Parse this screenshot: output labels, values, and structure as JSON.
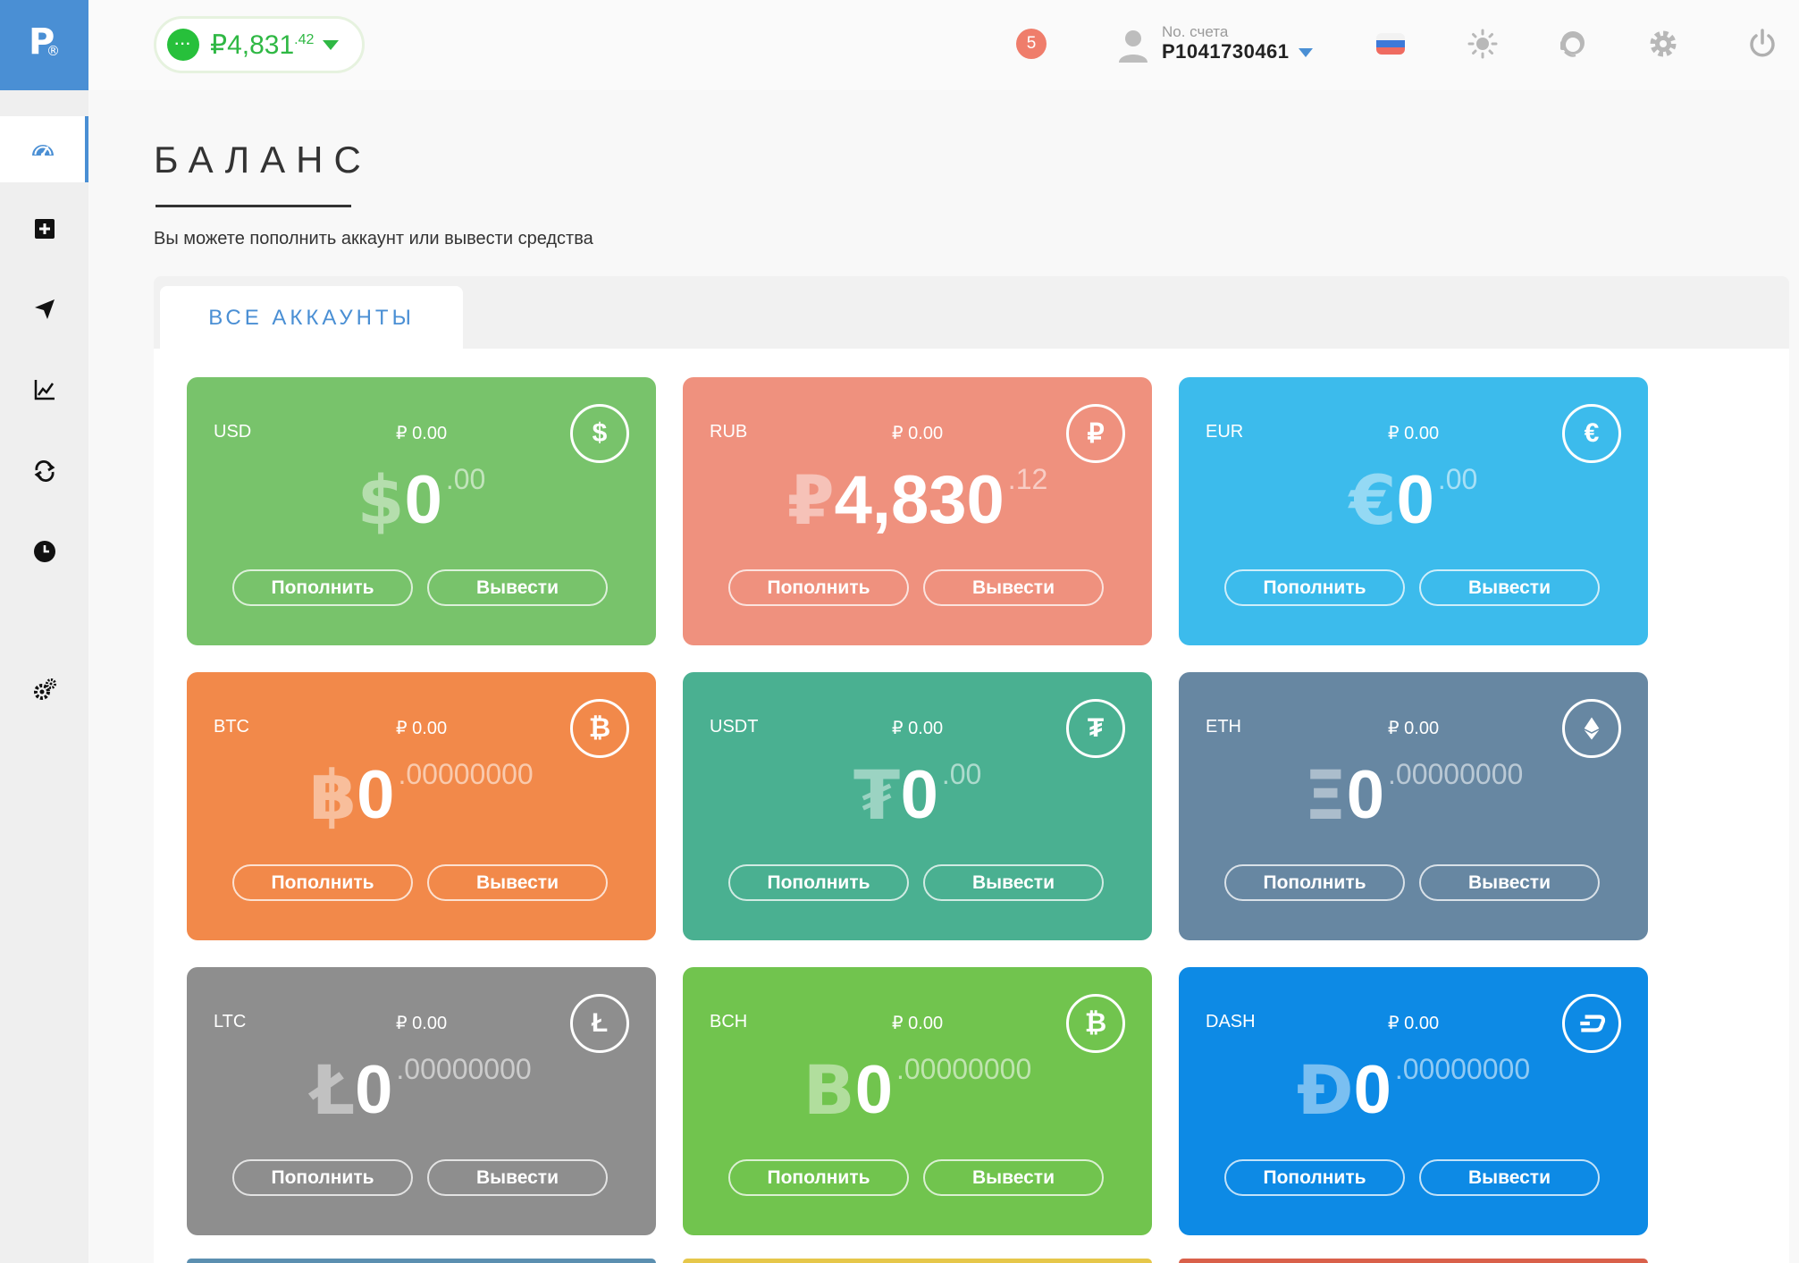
{
  "logo": {
    "letter": "P",
    "mark": "®"
  },
  "header": {
    "balance_main": "₽4,831",
    "balance_cents": ".42",
    "balance_dot": "···",
    "notifications": "5",
    "account_label": "No. счета",
    "account_number": "P1041730461"
  },
  "sidebar": {
    "items": [
      {
        "icon": "dashboard-gauge-icon"
      },
      {
        "icon": "add-square-icon"
      },
      {
        "icon": "send-paper-plane-icon"
      },
      {
        "icon": "chart-line-icon"
      },
      {
        "icon": "exchange-arrows-icon"
      },
      {
        "icon": "history-clock-icon"
      },
      {
        "icon": "settings-gears-icon"
      }
    ]
  },
  "page": {
    "title": "БАЛАНС",
    "subtitle": "Вы можете пополнить аккаунт или вывести средства",
    "tab": "ВСЕ АККАУНТЫ"
  },
  "labels": {
    "deposit": "Пополнить",
    "withdraw": "Вывести"
  },
  "cards": [
    {
      "code": "USD",
      "rub": "₽ 0.00",
      "icon": "$",
      "sym": "$",
      "int": "0",
      "frac": ".00",
      "color": "#78c36b"
    },
    {
      "code": "RUB",
      "rub": "₽ 0.00",
      "icon": "₽",
      "sym": "₽",
      "int": "4,830",
      "frac": ".12",
      "color": "#ef917e"
    },
    {
      "code": "EUR",
      "rub": "₽ 0.00",
      "icon": "€",
      "sym": "€",
      "int": "0",
      "frac": ".00",
      "color": "#3cbbec"
    },
    {
      "code": "BTC",
      "rub": "₽ 0.00",
      "icon": "₿",
      "sym": "฿",
      "int": "0",
      "frac": ".00000000",
      "color": "#f2894a"
    },
    {
      "code": "USDT",
      "rub": "₽ 0.00",
      "icon": "₮",
      "sym": "₮",
      "int": "0",
      "frac": ".00",
      "color": "#4ab091"
    },
    {
      "code": "ETH",
      "rub": "₽ 0.00",
      "icon": "ethereum",
      "sym": "Ξ",
      "int": "0",
      "frac": ".00000000",
      "color": "#6787a2"
    },
    {
      "code": "LTC",
      "rub": "₽ 0.00",
      "icon": "Ł",
      "sym": "Ł",
      "int": "0",
      "frac": ".00000000",
      "color": "#8e8e8e"
    },
    {
      "code": "BCH",
      "rub": "₽ 0.00",
      "icon": "₿",
      "sym": "B",
      "int": "0",
      "frac": ".00000000",
      "color": "#71c44e"
    },
    {
      "code": "DASH",
      "rub": "₽ 0.00",
      "icon": "dash",
      "sym": "Đ",
      "int": "0",
      "frac": ".00000000",
      "color": "#0d8ae5"
    }
  ],
  "next_row_colors": [
    "#5b8fb0",
    "#e6c74a",
    "#d9604a"
  ]
}
